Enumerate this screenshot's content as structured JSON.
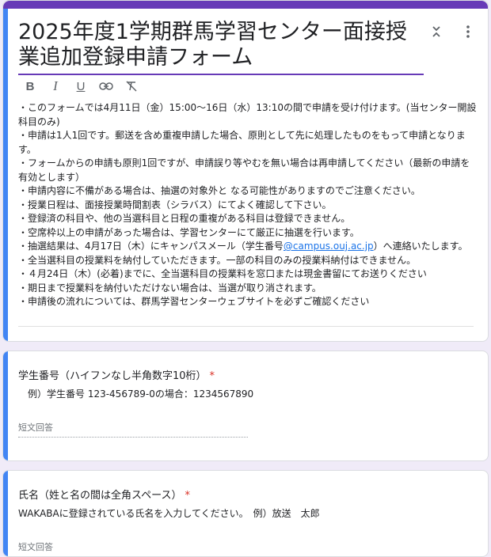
{
  "form": {
    "title": "2025年度1学期群馬学習センター面接授業追加登録申請フォーム",
    "description_lines": [
      "・このフォームでは4月11日（金）15:00～16日（水）13:10の間で申請を受け付けます。(当センター開設科目のみ)",
      "・申請は1人1回です。郵送を含め重複申請した場合、原則として先に処理したものをもって申請となります。",
      "・フォームからの申請も原則1回ですが、申請誤り等やむを無い場合は再申請してください（最新の申請を有効とします）",
      "・申請内容に不備がある場合は、抽選の対象外と なる可能性がありますのでご注意ください。",
      "・授業日程は、面接授業時間割表（シラバス）にてよく確認して下さい。",
      "・登録済の科目や、他の当選科目と日程の重複がある科目は登録できません。",
      "・空席枠以上の申請があった場合は、学習センターにて厳正に抽選を行います。",
      "・全当選科目の授業料を納付していただきます。一部の科目のみの授業料納付はできません。",
      "・４月24日（木）(必着)までに、全当選科目の授業料を窓口または現金書留にてお送りください",
      "・期日まで授業料を納付いただけない場合は、当選が取り消されます。",
      "・申請後の流れについては、群馬学習センターウェブサイトを必ずご確認ください"
    ],
    "lottery_line": {
      "before": "・抽選結果は、4月17日（木）にキャンパスメール（学生番号",
      "link": "@campus.ouj.ac.jp",
      "after": "）へ連絡いたします。"
    }
  },
  "toolbar": {
    "bold": "B",
    "italic": "I",
    "underline": "U"
  },
  "questions": [
    {
      "title": "学生番号（ハイフンなし半角数字10桁）",
      "required": "*",
      "help": "例）学生番号 123-456789-0の場合：1234567890",
      "placeholder": "短文回答"
    },
    {
      "title": "氏名（姓と名の間は全角スペース）",
      "required": "*",
      "help": "WAKABAに登録されている氏名を入力してください。　例）放送　太郎",
      "placeholder": "短文回答"
    }
  ],
  "colors": {
    "accent": "#673ab7",
    "active_bar": "#4285f4",
    "required": "#d93025",
    "link": "#1a73e8"
  }
}
